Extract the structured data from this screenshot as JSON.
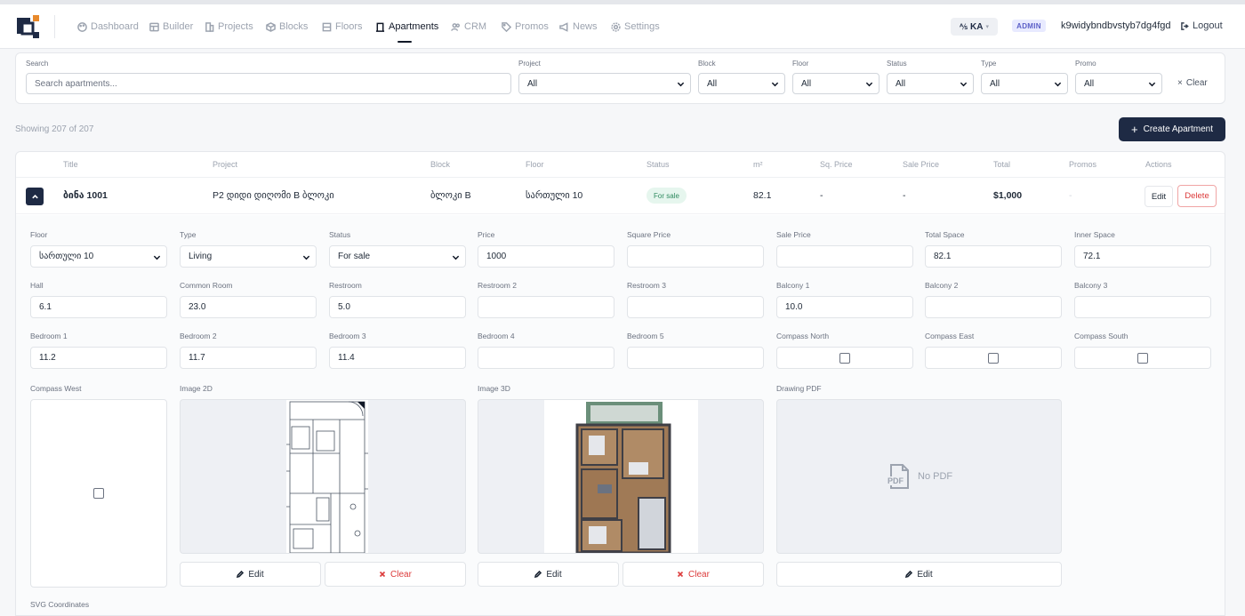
{
  "nav": {
    "items": [
      {
        "label": "Dashboard",
        "icon": "palette-icon"
      },
      {
        "label": "Builder",
        "icon": "grid-icon"
      },
      {
        "label": "Projects",
        "icon": "building-icon"
      },
      {
        "label": "Blocks",
        "icon": "cube-icon"
      },
      {
        "label": "Floors",
        "icon": "floor-icon"
      },
      {
        "label": "Apartments",
        "icon": "door-icon"
      },
      {
        "label": "CRM",
        "icon": "users-icon"
      },
      {
        "label": "Promos",
        "icon": "tag-icon"
      },
      {
        "label": "News",
        "icon": "megaphone-icon"
      },
      {
        "label": "Settings",
        "icon": "gear-icon"
      }
    ],
    "active": "Apartments",
    "language": "KA",
    "role_badge": "ADMIN",
    "username": "k9widybndbvstyb7dg4fgd",
    "logout_label": "Logout"
  },
  "filters": {
    "search_label": "Search",
    "search_placeholder": "Search apartments...",
    "project_label": "Project",
    "project_value": "All",
    "block_label": "Block",
    "block_value": "All",
    "floor_label": "Floor",
    "floor_value": "All",
    "status_label": "Status",
    "status_value": "All",
    "type_label": "Type",
    "type_value": "All",
    "promo_label": "Promo",
    "promo_value": "All",
    "clear_label": "Clear"
  },
  "summary": {
    "showing": "Showing 207 of 207",
    "create_label": "Create Apartment"
  },
  "table": {
    "columns": [
      "Title",
      "Project",
      "Block",
      "Floor",
      "Status",
      "m²",
      "Sq. Price",
      "Sale Price",
      "Total",
      "Promos",
      "Actions"
    ],
    "row": {
      "title": "ბინა 1001",
      "project": "P2 დიდი დიღომი B ბლოკი",
      "block": "ბლოკი B",
      "floor": "სართული 10",
      "status": "For sale",
      "area": "82.1",
      "sq_price": "-",
      "sale_price": "-",
      "total": "$1,000",
      "promos": "-",
      "edit_label": "Edit",
      "delete_label": "Delete"
    }
  },
  "detail": {
    "floor_label": "Floor",
    "floor_value": "სართული 10",
    "type_label": "Type",
    "type_value": "Living",
    "status_label": "Status",
    "status_value": "For sale",
    "price_label": "Price",
    "price_value": "1000",
    "square_price_label": "Square Price",
    "square_price_value": "",
    "sale_price_label": "Sale Price",
    "sale_price_value": "",
    "total_space_label": "Total Space",
    "total_space_value": "82.1",
    "inner_space_label": "Inner Space",
    "inner_space_value": "72.1",
    "hall_label": "Hall",
    "hall_value": "6.1",
    "common_room_label": "Common Room",
    "common_room_value": "23.0",
    "restroom_label": "Restroom",
    "restroom_value": "5.0",
    "restroom2_label": "Restroom 2",
    "restroom2_value": "",
    "restroom3_label": "Restroom 3",
    "restroom3_value": "",
    "balcony1_label": "Balcony 1",
    "balcony1_value": "10.0",
    "balcony2_label": "Balcony 2",
    "balcony2_value": "",
    "balcony3_label": "Balcony 3",
    "balcony3_value": "",
    "bedroom1_label": "Bedroom 1",
    "bedroom1_value": "11.2",
    "bedroom2_label": "Bedroom 2",
    "bedroom2_value": "11.7",
    "bedroom3_label": "Bedroom 3",
    "bedroom3_value": "11.4",
    "bedroom4_label": "Bedroom 4",
    "bedroom4_value": "",
    "bedroom5_label": "Bedroom 5",
    "bedroom5_value": "",
    "compass_north_label": "Compass North",
    "compass_east_label": "Compass East",
    "compass_south_label": "Compass South",
    "compass_west_label": "Compass West",
    "image2d_label": "Image 2D",
    "image3d_label": "Image 3D",
    "drawing_pdf_label": "Drawing PDF",
    "no_pdf_label": "No PDF",
    "pdf_icon_text": "PDF",
    "edit_label": "Edit",
    "clear_label": "Clear",
    "svg_coordinates_label": "SVG Coordinates"
  }
}
